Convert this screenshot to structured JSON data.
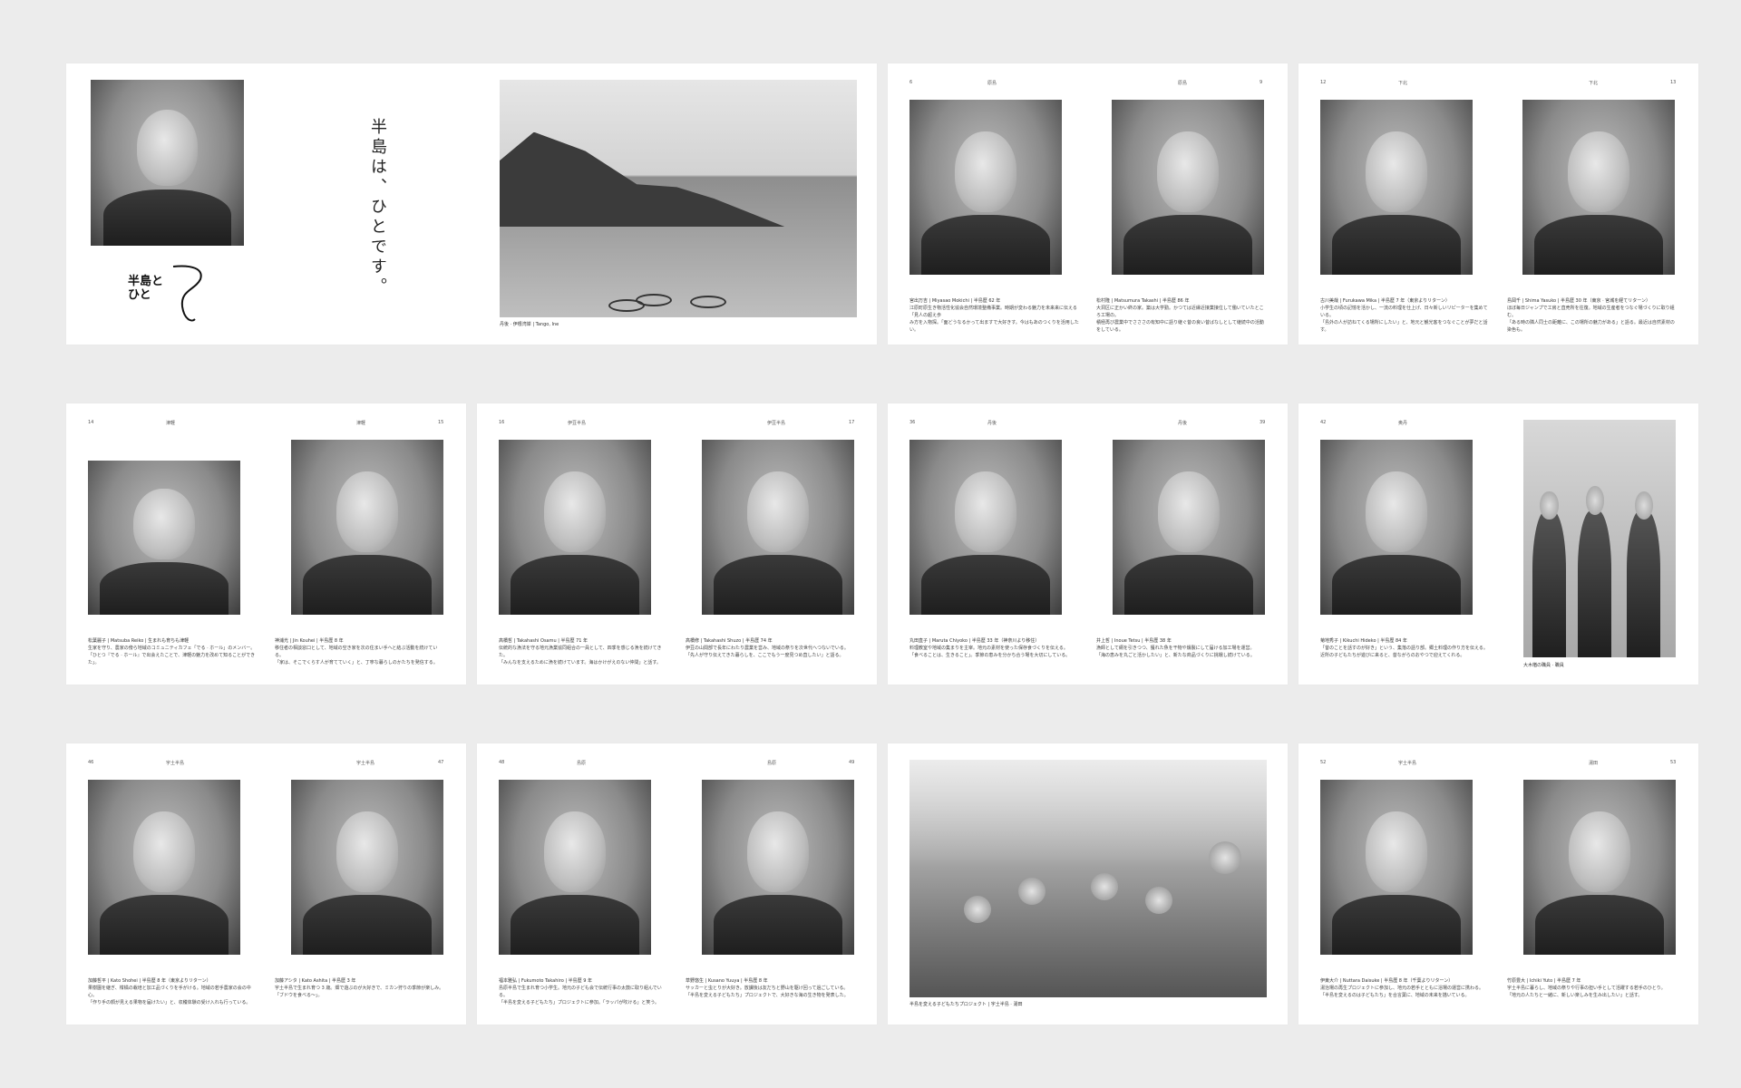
{
  "title_spread": {
    "vertical_title": "半島は、ひとです。",
    "logo_line1": "半島と",
    "logo_line2": "ひと",
    "landscape_caption": "丹後 · 伊根湾岸 | Tango, Ine"
  },
  "spreads": [
    {
      "id": "s2",
      "left_page_no": "6",
      "right_page_no": "9",
      "left_header": "原島",
      "right_header": "原島",
      "captions": [
        {
          "name": "宮出万吉 | Miyasao Mokichi | 半島歴 62 年",
          "line2": "江原町原生き物活性化協会自然環境整備事業。時期が変わる魅力を未来来に伝える「見人の超え歩",
          "line3": "み方を入物探。「面どうなるかって出ますで大好きす。今はもあのつくりを活用したい。"
        },
        {
          "name": "松村隆 | Matsumura Takashi | 半島歴 86 年",
          "line2": "大洞区に正かい終の家。築は大学勤。かつては近縁近接業接位して働いていたところ工場の。",
          "line3": "積極再び農業中でさささの有知中に語り継ぐ昔の良い昔ばなしとして継続中の活動をしている。"
        }
      ]
    },
    {
      "id": "s3",
      "left_page_no": "12",
      "right_page_no": "13",
      "left_header": "下北",
      "right_header": "下北",
      "captions": [
        {
          "name": "古川美哉 | Furukawa Mika | 半島歴 7 年（東京よりリターン）",
          "line2": "小学生の頃の記憶を活かし、一流の料理を仕上げ、日々新しいリピーターを集めている。",
          "line3": "「島外の人が訪ねてくる場所にしたい」と、地元と観光客をつなぐことが夢だと話す。"
        },
        {
          "name": "島岡千 | Shima Yasuko | 半島歴 30 年（東京 · 宮城を経てリターン）",
          "line2": "ほぼ毎日ジャンプで工房と直売所を往復。地域の生産者をつなぐ場づくりに取り組む。",
          "line3": "「ある時の隣人同士の距離に、この場所の魅力がある」と語る。最近は自然素材の染色も。"
        }
      ]
    },
    {
      "id": "s4",
      "left_page_no": "14",
      "right_page_no": "15",
      "left_header": "津軽",
      "right_header": "津軽",
      "captions": [
        {
          "name": "松葉麗子 | Matsuba Reiko | 生まれも育ちも津軽",
          "line2": "生家を守り、農家の傍ら地域のコミュニティカフェ「でる · ホール」のメンバー。",
          "line3": "「ひとつ『でる · ホール』で出会えたことで、津軽の魅力を改めて知ることができた」。"
        },
        {
          "name": "神浦光 | Jin Kouhei | 半島歴 8 年",
          "line2": "移住者の相談窓口として、地域の空き家を次の住まい手へと結ぶ活動を続けている。",
          "line3": "「家は、そこでくらす人が育てていく」と、丁寧な暮らしのかたちを発信する。"
        }
      ]
    },
    {
      "id": "s5",
      "left_page_no": "16",
      "right_page_no": "17",
      "left_header": "伊豆半島",
      "right_header": "伊豆半島",
      "captions": [
        {
          "name": "高橋哲 | Takahashi Osamu | 半島歴 71 年",
          "line2": "伝統的な漁法を守る地元漁業協同組合の一員として、四季を感じる漁を続けてきた。",
          "line3": "「みんなを支えるために漁を続けています。海はかけがえのない仲間」と話す。"
        },
        {
          "name": "高橋修 | Takahashi Shuzo | 半島歴 74 年",
          "line2": "伊豆の山間部で長年にわたり農業を営み、地域の祭りを次世代へつないでいる。",
          "line3": "「先人が守り伝えてきた暮らしを、ここでもう一度見つめ直したい」と語る。"
        }
      ]
    },
    {
      "id": "s6",
      "left_page_no": "36",
      "right_page_no": "39",
      "left_header": "丹後",
      "right_header": "丹後",
      "captions": [
        {
          "name": "丸田直子 | Maruta Chiyoko | 半島歴 33 年（神奈川より移住）",
          "line2": "料理教室や地域の集まりを主宰。地元の素材を使った保存食づくりを伝える。",
          "line3": "「食べることは、生きること」。季節の恵みを分かち合う場を大切にしている。"
        },
        {
          "name": "井上哲 | Inoue Tetsu | 半島歴 38 年",
          "line2": "漁師として網を引きつつ、獲れた魚を干物や燻製にして届ける加工場を運営。",
          "line3": "「海の恵みを丸ごと活かしたい」と、新たな商品づくりに挑戦し続けている。"
        }
      ]
    },
    {
      "id": "s7",
      "left_page_no": "42",
      "right_page_no": "",
      "left_header": "奥丹",
      "right_header": "",
      "captions": [
        {
          "name": "菊地秀子 | Kikuchi Hideko | 半島歴 84 年",
          "line2": "「昔のことを話すのが好き」という、集落の語り部。郷土料理の作り方を伝える。",
          "line3": "近所の子どもたちが遊びに来ると、昔ながらのおやつで迎えてくれる。"
        },
        {
          "name": "大木楢の職員 · 職員",
          "line2": "",
          "line3": ""
        }
      ]
    },
    {
      "id": "s8",
      "left_page_no": "46",
      "right_page_no": "47",
      "left_header": "宇土半島",
      "right_header": "宇土半島",
      "captions": [
        {
          "name": "加藤哲平 | Kato Shohei | 半島歴 8 年（東京よりリターン）",
          "line2": "果樹園を継ぎ、柑橘の栽培と加工品づくりを手がける。地域の若手農家の会の中心。",
          "line3": "「作り手の顔が見える果物を届けたい」と、収穫体験の受け入れも行っている。"
        },
        {
          "name": "加藤アシタ | Kato Ashita | 半島歴 3 年",
          "line2": "宇土半島で生まれ育つ 3 歳。畑で遊ぶのが大好きで、ミカン狩りの季節が楽しみ。",
          "line3": "「ブドウを食べる～」。"
        }
      ]
    },
    {
      "id": "s9",
      "left_page_no": "48",
      "right_page_no": "49",
      "left_header": "島原",
      "right_header": "島原",
      "captions": [
        {
          "name": "福本雅弘 | Fukumoto Takahiro | 半島歴 9 年",
          "line2": "島原半島で生まれ育つ小学生。地元の子ども会で伝統行事の太鼓に取り組んでいる。",
          "line3": "「半島を変える子どもたち」プロジェクトに参加。「ラッパが吹ける」と笑う。"
        },
        {
          "name": "草野悠生 | Kusano Yuuya | 半島歴 8 年",
          "line2": "サッカーと虫とりが大好き。放課後は友だちと野山を駆け回って過ごしている。",
          "line3": "「半島を変える子どもたち」プロジェクトで、大好きな海の生き物を発表した。"
        }
      ]
    },
    {
      "id": "s10",
      "left_page_no": "",
      "right_page_no": "",
      "left_header": "",
      "right_header": "",
      "captions": [
        {
          "name": "半島を変える子どもたちプロジェクト | 宇土半島 · 湯田",
          "line2": "",
          "line3": ""
        }
      ]
    },
    {
      "id": "s11",
      "left_page_no": "52",
      "right_page_no": "53",
      "left_header": "宇土半島",
      "right_header": "湯田",
      "captions": [
        {
          "name": "伊東大介 | Nuttara Daisuke | 半島歴 8 年（千葉よりリターン）",
          "line2": "湯治場の再生プロジェクトに参加し、地元の若手とともに浴場の運営に携わる。",
          "line3": "「半島を変えるのは子どもたち」を合言葉に、地域の未来を描いている。"
        },
        {
          "name": "竹原豊大 | Ichiki Yuto | 半島歴 7 年",
          "line2": "宇土半島に暮らし、地域の祭りや行事の担い手として活躍する若手のひとり。",
          "line3": "「地元の人たちと一緒に、新しい楽しみを生み出したい」と話す。"
        }
      ]
    }
  ]
}
